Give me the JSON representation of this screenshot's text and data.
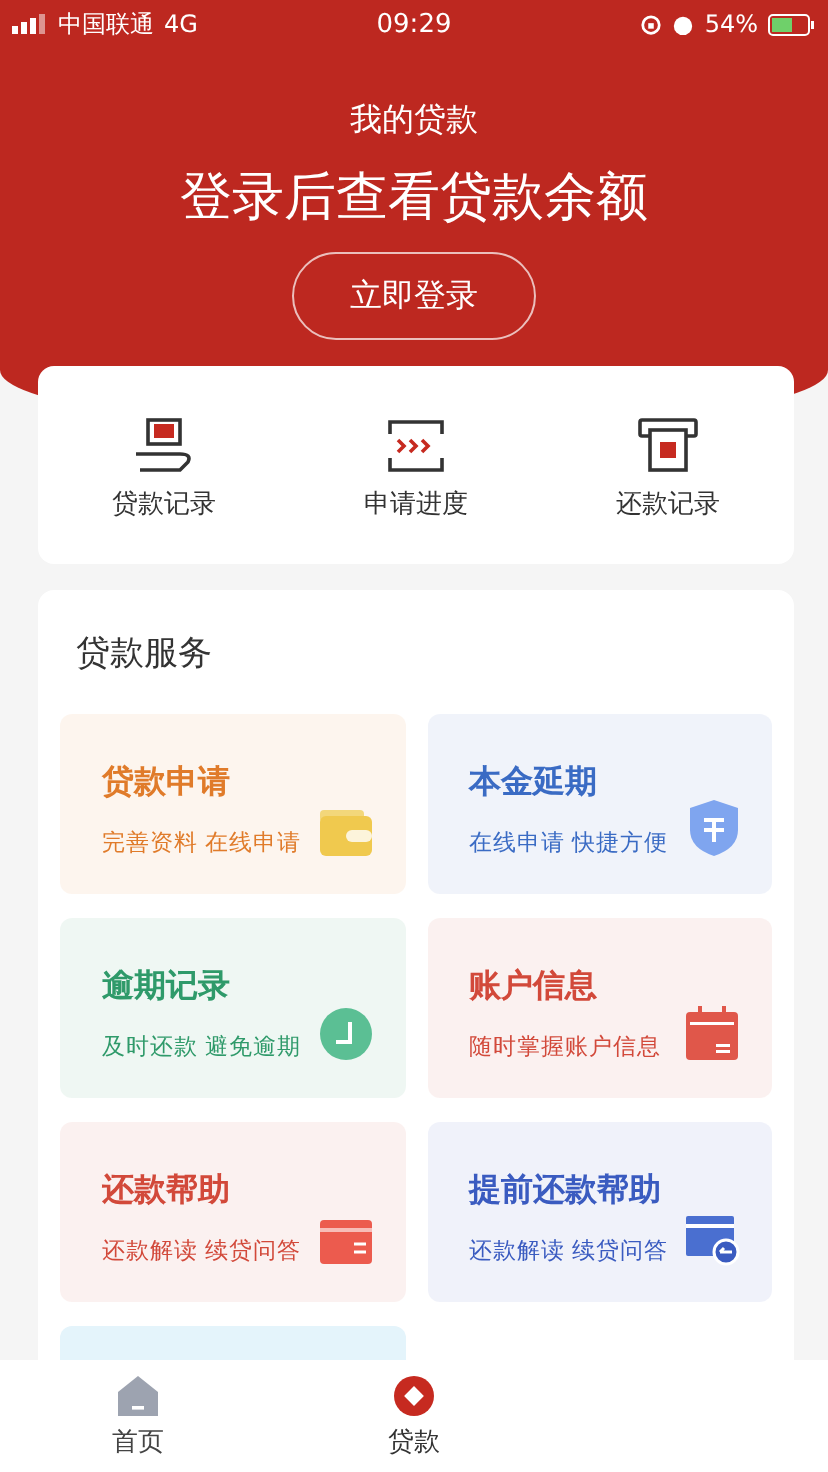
{
  "status_bar": {
    "carrier": "中国联通",
    "network": "4G",
    "time": "09:29",
    "battery": "54%"
  },
  "header": {
    "title": "我的贷款",
    "headline": "登录后查看贷款余额",
    "login_button": "立即登录"
  },
  "quick_links": [
    {
      "label": "贷款记录",
      "kind": "loan"
    },
    {
      "label": "申请进度",
      "kind": "progress"
    },
    {
      "label": "还款记录",
      "kind": "repay"
    }
  ],
  "services": {
    "title": "贷款服务",
    "tiles": [
      {
        "title": "贷款申请",
        "subtitle": "完善资料 在线申请",
        "kind": "wallet",
        "color": "#e07b2a"
      },
      {
        "title": "本金延期",
        "subtitle": "在线申请 快捷方便",
        "kind": "shield",
        "color": "#3a6bc4"
      },
      {
        "title": "逾期记录",
        "subtitle": "及时还款 避免逾期",
        "kind": "clock",
        "color": "#2f9a6a"
      },
      {
        "title": "账户信息",
        "subtitle": "随时掌握账户信息",
        "kind": "calendar",
        "color": "#d2493a"
      },
      {
        "title": "还款帮助",
        "subtitle": "还款解读 续贷问答",
        "kind": "card",
        "color": "#d2493a"
      },
      {
        "title": "提前还款帮助",
        "subtitle": "还款解读 续贷问答",
        "kind": "screen",
        "color": "#3a5bc0"
      },
      {
        "kind": "partial"
      }
    ]
  },
  "tab_bar": [
    {
      "label": "首页",
      "selected": false
    },
    {
      "label": "贷款",
      "selected": true
    }
  ]
}
